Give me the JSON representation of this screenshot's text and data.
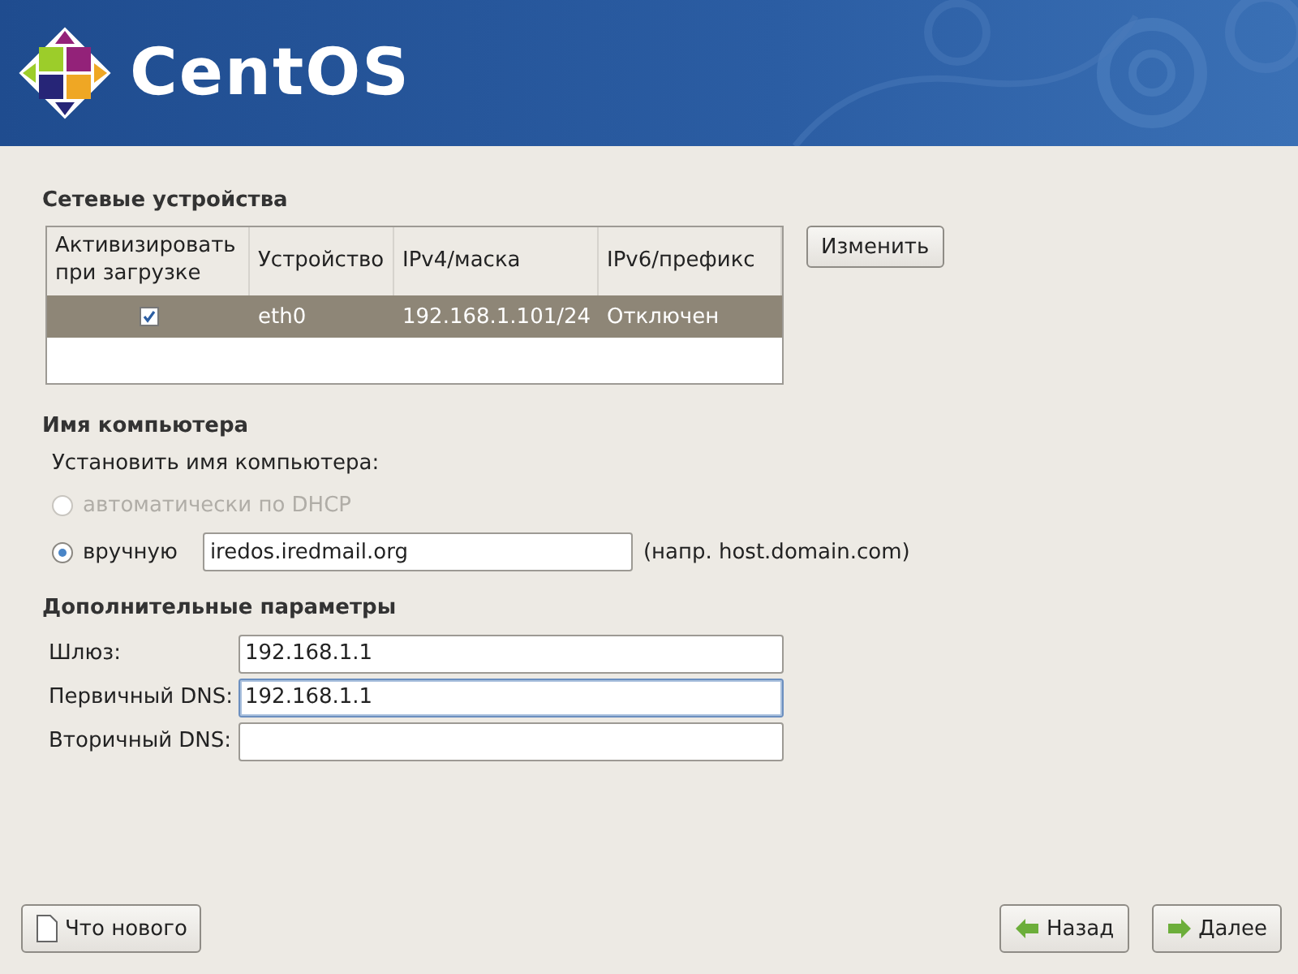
{
  "header": {
    "logo_text": "CentOS"
  },
  "devices": {
    "title": "Сетевые устройства",
    "columns": [
      "Активизировать при загрузке",
      "Устройство",
      "IPv4/маска",
      "IPv6/префикс"
    ],
    "rows": [
      {
        "active": true,
        "device": "eth0",
        "ipv4": "192.168.1.101/24",
        "ipv6": "Отключен",
        "selected": true
      }
    ],
    "edit_button": "Изменить"
  },
  "hostname": {
    "title": "Имя компьютера",
    "prompt": "Установить имя компьютера:",
    "options": [
      {
        "label": "автоматически по DHCP",
        "selected": false,
        "disabled": true
      },
      {
        "label": "вручную",
        "selected": true,
        "disabled": false,
        "value": "iredos.iredmail.org",
        "hint": "(напр. host.domain.com)"
      }
    ]
  },
  "misc": {
    "title": "Дополнительные параметры",
    "fields": [
      {
        "label": "Шлюз:",
        "value": "192.168.1.1",
        "focused": false
      },
      {
        "label": "Первичный DNS:",
        "value": "192.168.1.1",
        "focused": true
      },
      {
        "label": "Вторичный DNS:",
        "focused": false
      }
    ]
  },
  "buttons": {
    "release_notes": "Что нового",
    "back": "Назад",
    "next": "Далее"
  }
}
